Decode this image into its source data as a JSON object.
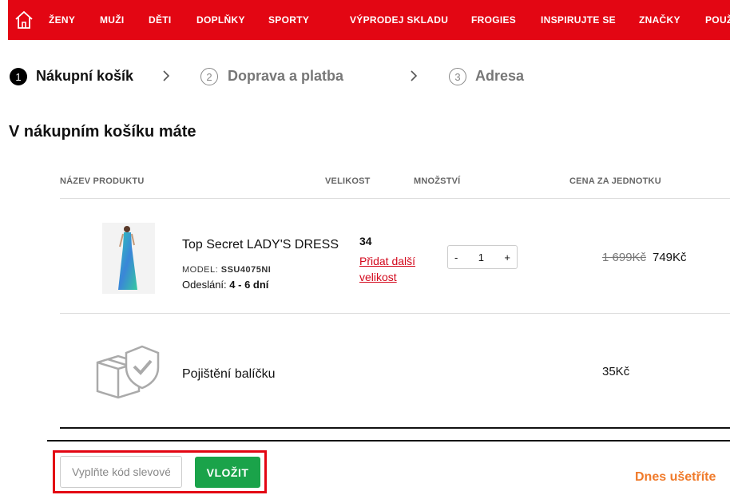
{
  "nav": {
    "items": [
      "ŽENY",
      "MUŽI",
      "DĚTI",
      "DOPLŇKY",
      "SPORTY",
      "VÝPRODEJ SKLADU",
      "FROGIES",
      "INSPIRUJTE SE",
      "ZNAČKY",
      "POUŽ"
    ],
    "icon": "home-icon",
    "color": "#e30613"
  },
  "steps": [
    {
      "num": "1",
      "label": "Nákupní košík"
    },
    {
      "num": "2",
      "label": "Doprava a platba"
    },
    {
      "num": "3",
      "label": "Adresa"
    }
  ],
  "cart": {
    "title": "V nákupním košíku máte",
    "headers": {
      "product": "NÁZEV PRODUKTU",
      "size": "VELIKOST",
      "quantity": "MNOŽSTVÍ",
      "unit_price": "CENA ZA JEDNOTKU"
    },
    "item": {
      "name": "Top Secret LADY'S DRESS",
      "model_label": "MODEL:",
      "model": "SSU4075NI",
      "shipping_label": "Odeslání:",
      "shipping": "4 - 6 dní",
      "size": "34",
      "add_size": "Přidat další velikost",
      "qty_minus": "-",
      "qty": "1",
      "qty_plus": "+",
      "old_price": "1 699Kč",
      "price": "749Kč"
    },
    "insurance": {
      "name": "Pojištění balíčku",
      "price": "35Kč",
      "icon": "package-shield-icon"
    }
  },
  "coupon": {
    "placeholder": "Vyplňte kód slevového kupónu",
    "button": "VLOŽIT"
  },
  "save_today": "Dnes ušetříte"
}
